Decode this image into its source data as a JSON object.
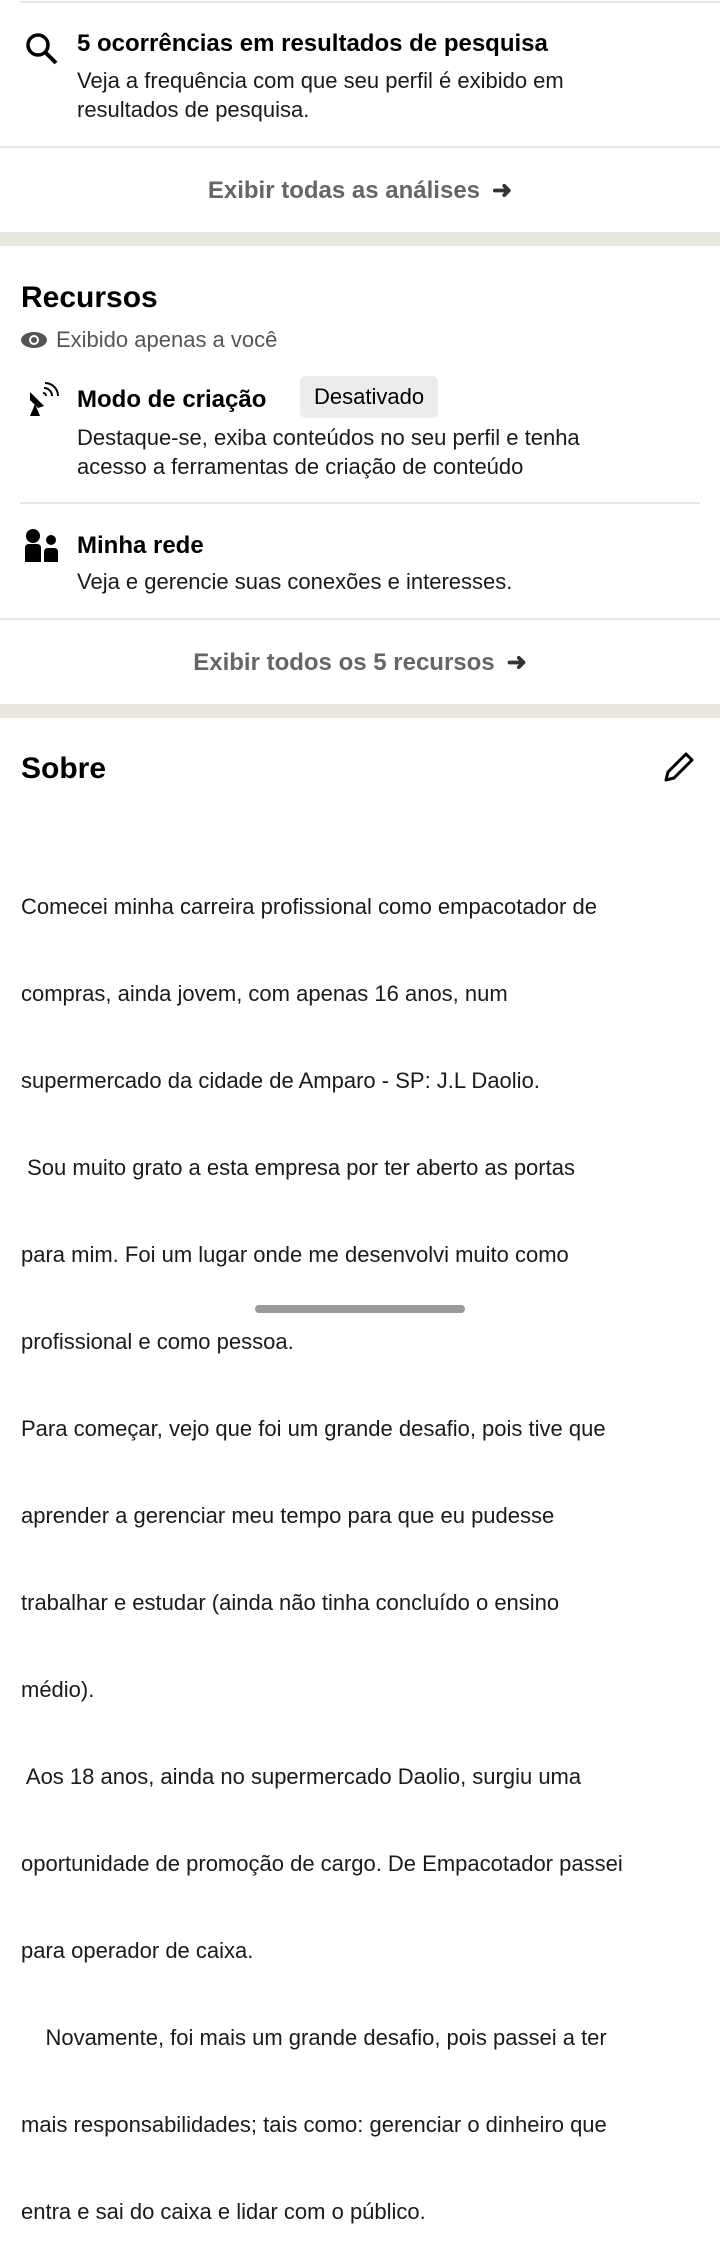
{
  "analytics": {
    "search_title": "5 ocorrências em resultados de pesquisa",
    "search_desc": [
      "Veja a frequência com que seu perfil é exibido em",
      "resultados de pesquisa."
    ],
    "show_all": "Exibir todas as análises"
  },
  "resources": {
    "title": "Recursos",
    "visibility": "Exibido apenas a você",
    "items": [
      {
        "title": "Modo de criação",
        "badge": "Desativado",
        "desc": [
          "Destaque-se, exiba conteúdos no seu perfil e tenha",
          "acesso a ferramentas de criação de conteúdo"
        ]
      },
      {
        "title": "Minha rede",
        "desc": [
          "Veja e gerencie suas conexões e interesses."
        ]
      }
    ],
    "show_all": "Exibir todos os 5 recursos"
  },
  "about": {
    "title": "Sobre",
    "lines": [
      "Comecei minha carreira profissional como empacotador de",
      "compras, ainda jovem, com apenas 16 anos, num",
      "supermercado da cidade de Amparo - SP: J.L Daolio.",
      " Sou muito grato a esta empresa por ter aberto as portas",
      "para mim. Foi um lugar onde me desenvolvi muito como",
      "profissional e como pessoa.",
      "Para começar, vejo que foi um grande desafio, pois tive que",
      "aprender a gerenciar meu tempo para que eu pudesse",
      "trabalhar e estudar (ainda não tinha concluído o ensino",
      "médio).",
      " Aos 18 anos, ainda no supermercado Daolio, surgiu uma",
      "oportunidade de promoção de cargo. De Empacotador passei",
      "para operador de caixa.",
      "    Novamente, foi mais um grande desafio, pois passei a ter",
      "mais responsabilidades; tais como: gerenciar o dinheiro que",
      "entra e sai do caixa e lidar com o público."
    ]
  }
}
